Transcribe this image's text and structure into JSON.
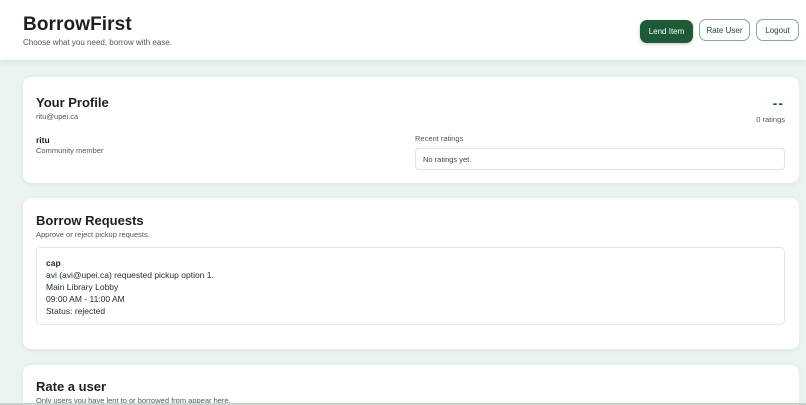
{
  "header": {
    "title": "BorrowFirst",
    "tagline": "Choose what you need, borrow with ease.",
    "lend_label": "Lend Item",
    "rate_label": "Rate User",
    "logout_label": "Logout"
  },
  "profile": {
    "title": "Your Profile",
    "email": "ritu@upei.ca",
    "rating_score": "--",
    "rating_count": "0 ratings",
    "name": "ritu",
    "role": "Community member",
    "recent_label": "Recent ratings",
    "recent_empty": "No ratings yet."
  },
  "requests": {
    "title": "Borrow Requests",
    "subtitle": "Approve or reject pickup requests.",
    "items": [
      {
        "item": "cap",
        "requester": "avi (avi@upei.ca) requested pickup option 1.",
        "location": "Main Library Lobby",
        "time": "09:00 AM - 11:00 AM",
        "status": "Status: rejected"
      }
    ]
  },
  "rate": {
    "title": "Rate a user",
    "subtitle": "Only users you have lent to or borrowed from appear here."
  },
  "colors": {
    "accent": "#1e5a38",
    "background": "#eaf3ed"
  }
}
